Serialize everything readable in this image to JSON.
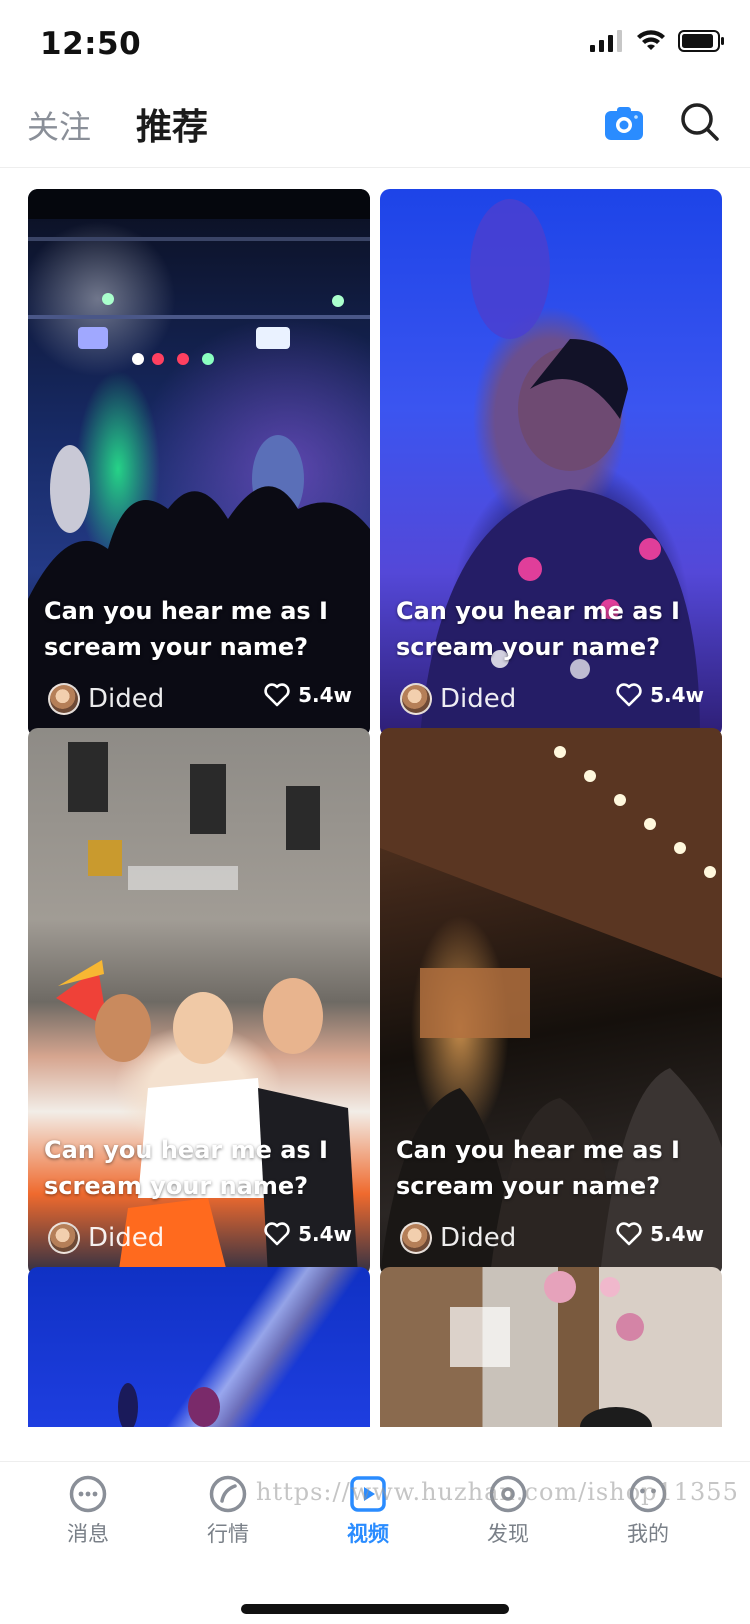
{
  "status_bar": {
    "time": "12:50"
  },
  "header": {
    "tabs": [
      {
        "label": "关注",
        "active": false
      },
      {
        "label": "推荐",
        "active": true
      }
    ],
    "camera_icon": "camera-icon",
    "search_icon": "search-icon",
    "accent_color": "#2a8cff"
  },
  "feed": {
    "cards": [
      {
        "title": "Can you hear me as I scream your name?",
        "author": "Dided",
        "likes": "5.4w"
      },
      {
        "title": "Can you hear me as I scream your name?",
        "author": "Dided",
        "likes": "5.4w"
      },
      {
        "title": "Can you hear me as I scream your name?",
        "author": "Dided",
        "likes": "5.4w"
      },
      {
        "title": "Can you hear me as I scream your name?",
        "author": "Dided",
        "likes": "5.4w"
      }
    ]
  },
  "tabbar": {
    "items": [
      {
        "label": "消息",
        "icon": "message-face-icon",
        "active": false
      },
      {
        "label": "行情",
        "icon": "compass-icon",
        "active": false
      },
      {
        "label": "视频",
        "icon": "video-play-icon",
        "active": true
      },
      {
        "label": "发现",
        "icon": "discover-icon",
        "active": false
      },
      {
        "label": "我的",
        "icon": "profile-face-icon",
        "active": false
      }
    ]
  },
  "watermark": "https://www.huzhan.com/ishop11355"
}
